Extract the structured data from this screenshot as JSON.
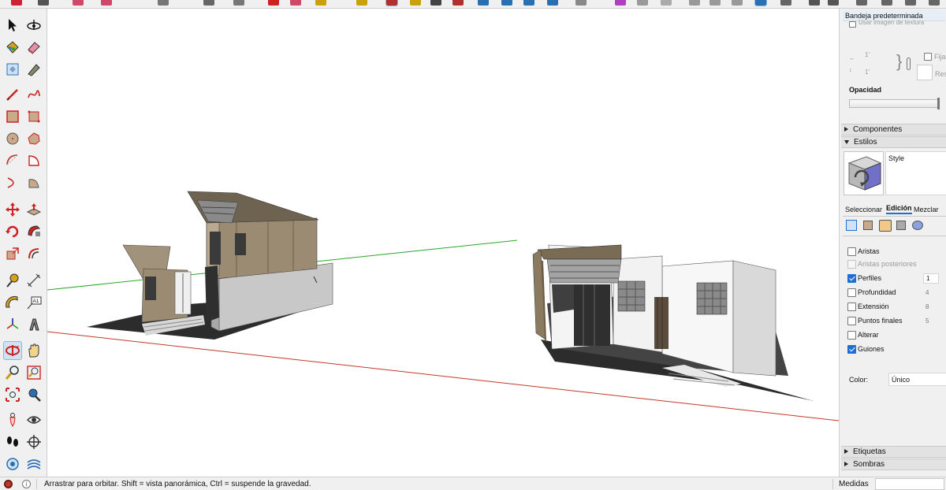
{
  "tray": {
    "title": "Bandeja predeterminada",
    "texture_checkbox": "Usar imagen de textura",
    "dim_width": "1'",
    "dim_height": "1'",
    "fix_label": "Fija",
    "reset_label": "Res",
    "opacity_label": "Opacidad",
    "panels": {
      "componentes": "Componentes",
      "estilos": "Estilos",
      "etiquetas": "Etiquetas",
      "sombras": "Sombras"
    },
    "style_name": "Style",
    "tabs": [
      "Seleccionar",
      "Edición",
      "Mezclar"
    ],
    "edge_settings": [
      {
        "label": "Aristas",
        "checked": false,
        "disabled": false,
        "value": ""
      },
      {
        "label": "Aristas posteriores",
        "checked": false,
        "disabled": true,
        "value": ""
      },
      {
        "label": "Perfiles",
        "checked": true,
        "disabled": false,
        "value": "1"
      },
      {
        "label": "Profundidad",
        "checked": false,
        "disabled": false,
        "value": "4"
      },
      {
        "label": "Extensión",
        "checked": false,
        "disabled": false,
        "value": "8"
      },
      {
        "label": "Puntos finales",
        "checked": false,
        "disabled": false,
        "value": "5"
      },
      {
        "label": "Alterar",
        "checked": false,
        "disabled": false,
        "value": ""
      },
      {
        "label": "Guiones",
        "checked": true,
        "disabled": false,
        "value": ""
      }
    ],
    "color_label": "Color:",
    "color_value": "Único"
  },
  "status": {
    "message": "Arrastrar para orbitar. Shift = vista panorámica, Ctrl = suspende la gravedad.",
    "measure_label": "Medidas",
    "measure_value": ""
  },
  "tools": [
    "select-icon",
    "orbit-icon",
    "paint-bucket-icon",
    "eraser-icon",
    "tag-tool-icon",
    "tape-icon",
    "line-icon",
    "freehand-icon",
    "rectangle-icon",
    "rotated-rectangle-icon",
    "circle-icon",
    "polygon-icon",
    "arc-icon",
    "pie-icon",
    "two-point-arc-icon",
    "three-point-arc-icon",
    "move-icon",
    "push-pull-icon",
    "rotate-icon",
    "follow-me-icon",
    "scale-icon",
    "offset-icon",
    "tape-measure-icon",
    "dimension-icon",
    "protractor-icon",
    "text-icon",
    "axes-icon",
    "3d-text-icon",
    "orbit-tool-icon",
    "pan-icon",
    "zoom-icon",
    "zoom-window-icon",
    "zoom-extents-icon",
    "previous-view-icon",
    "position-camera-icon",
    "look-around-icon",
    "walk-icon",
    "section-plane-icon",
    "sandbox-icon",
    "advanced-camera-icon"
  ],
  "colors": {
    "chrome": "#f0f0f0",
    "accent": "#1e6fd2",
    "axis_red": "#c0392b",
    "axis_green": "#2aa52a",
    "wood": "#9b8b72",
    "ground": "#2f2f2f"
  }
}
